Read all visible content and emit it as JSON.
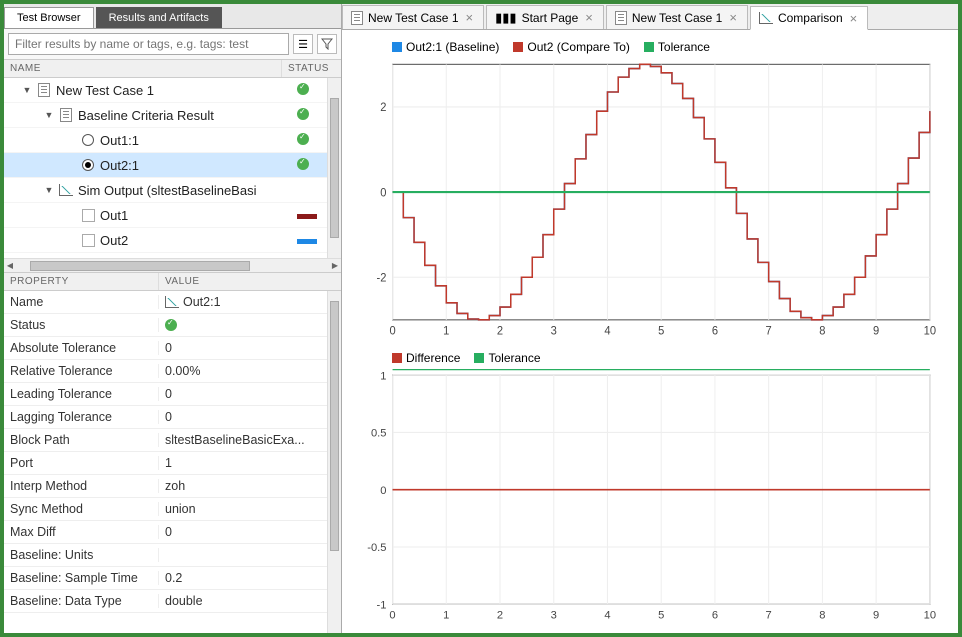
{
  "left_tabs": {
    "browser": "Test Browser",
    "results": "Results and Artifacts"
  },
  "filter": {
    "placeholder": "Filter results by name or tags, e.g. tags: test"
  },
  "tree_header": {
    "name": "NAME",
    "status": "STATUS"
  },
  "tree": [
    {
      "indent": 0,
      "arrow": "▼",
      "iconType": "doc",
      "label": "New Test Case 1",
      "status": "ok"
    },
    {
      "indent": 1,
      "arrow": "▼",
      "iconType": "doc",
      "label": "Baseline Criteria Result",
      "status": "ok"
    },
    {
      "indent": 2,
      "arrow": "",
      "iconType": "radio",
      "label": "Out1:1",
      "status": "ok"
    },
    {
      "indent": 2,
      "arrow": "",
      "iconType": "radio-checked",
      "label": "Out2:1",
      "status": "ok",
      "selected": true
    },
    {
      "indent": 1,
      "arrow": "▼",
      "iconType": "chart",
      "label": "Sim Output (sltestBaselineBasi",
      "status": ""
    },
    {
      "indent": 2,
      "arrow": "",
      "iconType": "checkbox",
      "label": "Out1",
      "swatch": "#8b1a1a"
    },
    {
      "indent": 2,
      "arrow": "",
      "iconType": "checkbox",
      "label": "Out2",
      "swatch": "#1e88e5"
    }
  ],
  "prop_header": {
    "property": "PROPERTY",
    "value": "VALUE"
  },
  "props": [
    {
      "k": "Name",
      "v": "Out2:1",
      "icon": "chart"
    },
    {
      "k": "Status",
      "v": "",
      "icon": "ok"
    },
    {
      "k": "Absolute Tolerance",
      "v": "0"
    },
    {
      "k": "Relative Tolerance",
      "v": "0.00%"
    },
    {
      "k": "Leading Tolerance",
      "v": "0"
    },
    {
      "k": "Lagging Tolerance",
      "v": "0"
    },
    {
      "k": "Block Path",
      "v": "sltestBaselineBasicExa..."
    },
    {
      "k": "Port",
      "v": "1"
    },
    {
      "k": "Interp Method",
      "v": "zoh"
    },
    {
      "k": "Sync Method",
      "v": "union"
    },
    {
      "k": "Max Diff",
      "v": "0"
    },
    {
      "k": "Baseline: Units",
      "v": ""
    },
    {
      "k": "Baseline: Sample Time",
      "v": "0.2"
    },
    {
      "k": "Baseline: Data Type",
      "v": "double"
    }
  ],
  "editor_tabs": [
    {
      "label": "New Test Case 1",
      "icon": "doc"
    },
    {
      "label": "Start Page",
      "icon": "books"
    },
    {
      "label": "New Test Case 1",
      "icon": "doc"
    },
    {
      "label": "Comparison",
      "icon": "chart",
      "active": true
    }
  ],
  "chart1": {
    "legend": [
      {
        "label": "Out2:1 (Baseline)",
        "color": "#1e88e5"
      },
      {
        "label": "Out2 (Compare To)",
        "color": "#c0392b"
      },
      {
        "label": "Tolerance",
        "color": "#27ae60"
      }
    ]
  },
  "chart2": {
    "legend": [
      {
        "label": "Difference",
        "color": "#c0392b"
      },
      {
        "label": "Tolerance",
        "color": "#27ae60"
      }
    ]
  },
  "chart_data": [
    {
      "type": "line",
      "title": "",
      "xlabel": "",
      "ylabel": "",
      "xlim": [
        0,
        10
      ],
      "ylim": [
        -3,
        3
      ],
      "xticks": [
        0,
        1,
        2,
        3,
        4,
        5,
        6,
        7,
        8,
        9,
        10
      ],
      "yticks": [
        -2,
        0,
        2
      ],
      "series": [
        {
          "name": "Out2:1 (Baseline)",
          "color": "#1e88e5",
          "interp": "zoh",
          "x": [
            0,
            0.2,
            0.4,
            0.6,
            0.8,
            1,
            1.2,
            1.4,
            1.6,
            1.8,
            2,
            2.2,
            2.4,
            2.6,
            2.8,
            3,
            3.2,
            3.4,
            3.6,
            3.8,
            4,
            4.2,
            4.4,
            4.6,
            4.8,
            5,
            5.2,
            5.4,
            5.6,
            5.8,
            6,
            6.2,
            6.4,
            6.6,
            6.8,
            7,
            7.2,
            7.4,
            7.6,
            7.8,
            8,
            8.2,
            8.4,
            8.6,
            8.8,
            9,
            9.2,
            9.4,
            9.6,
            9.8,
            10
          ],
          "y": [
            0,
            -0.6,
            -1.18,
            -1.72,
            -2.2,
            -2.6,
            -2.85,
            -2.98,
            -3,
            -2.9,
            -2.7,
            -2.4,
            -2,
            -1.53,
            -1,
            -0.4,
            0.2,
            0.78,
            1.35,
            1.9,
            2.35,
            2.7,
            2.9,
            3,
            2.95,
            2.8,
            2.55,
            2.2,
            1.75,
            1.25,
            0.7,
            0.1,
            -0.5,
            -1.1,
            -1.65,
            -2.1,
            -2.5,
            -2.8,
            -2.95,
            -3,
            -2.9,
            -2.7,
            -2.4,
            -2,
            -1.5,
            -1,
            -0.4,
            0.2,
            0.8,
            1.4,
            1.9
          ]
        },
        {
          "name": "Out2 (Compare To)",
          "color": "#c0392b",
          "interp": "zoh",
          "x": [
            0,
            0.2,
            0.4,
            0.6,
            0.8,
            1,
            1.2,
            1.4,
            1.6,
            1.8,
            2,
            2.2,
            2.4,
            2.6,
            2.8,
            3,
            3.2,
            3.4,
            3.6,
            3.8,
            4,
            4.2,
            4.4,
            4.6,
            4.8,
            5,
            5.2,
            5.4,
            5.6,
            5.8,
            6,
            6.2,
            6.4,
            6.6,
            6.8,
            7,
            7.2,
            7.4,
            7.6,
            7.8,
            8,
            8.2,
            8.4,
            8.6,
            8.8,
            9,
            9.2,
            9.4,
            9.6,
            9.8,
            10
          ],
          "y": [
            0,
            -0.6,
            -1.18,
            -1.72,
            -2.2,
            -2.6,
            -2.85,
            -2.98,
            -3,
            -2.9,
            -2.7,
            -2.4,
            -2,
            -1.53,
            -1,
            -0.4,
            0.2,
            0.78,
            1.35,
            1.9,
            2.35,
            2.7,
            2.9,
            3,
            2.95,
            2.8,
            2.55,
            2.2,
            1.75,
            1.25,
            0.7,
            0.1,
            -0.5,
            -1.1,
            -1.65,
            -2.1,
            -2.5,
            -2.8,
            -2.95,
            -3,
            -2.9,
            -2.7,
            -2.4,
            -2,
            -1.5,
            -1,
            -0.4,
            0.2,
            0.8,
            1.4,
            1.9
          ]
        },
        {
          "name": "Tolerance",
          "color": "#27ae60",
          "x": [
            0,
            10
          ],
          "y_upper": [
            0,
            0
          ],
          "y_lower": [
            0,
            0
          ]
        }
      ]
    },
    {
      "type": "line",
      "title": "",
      "xlabel": "",
      "ylabel": "",
      "xlim": [
        0,
        10
      ],
      "ylim": [
        -1,
        1
      ],
      "xticks": [
        0,
        1,
        2,
        3,
        4,
        5,
        6,
        7,
        8,
        9,
        10
      ],
      "yticks": [
        -1,
        -0.5,
        0,
        0.5,
        1
      ],
      "series": [
        {
          "name": "Difference",
          "color": "#c0392b",
          "x": [
            0,
            10
          ],
          "y": [
            0,
            0
          ]
        },
        {
          "name": "Tolerance",
          "color": "#27ae60",
          "x": [
            0,
            10
          ],
          "y": [
            1.05,
            1.05
          ]
        }
      ]
    }
  ]
}
